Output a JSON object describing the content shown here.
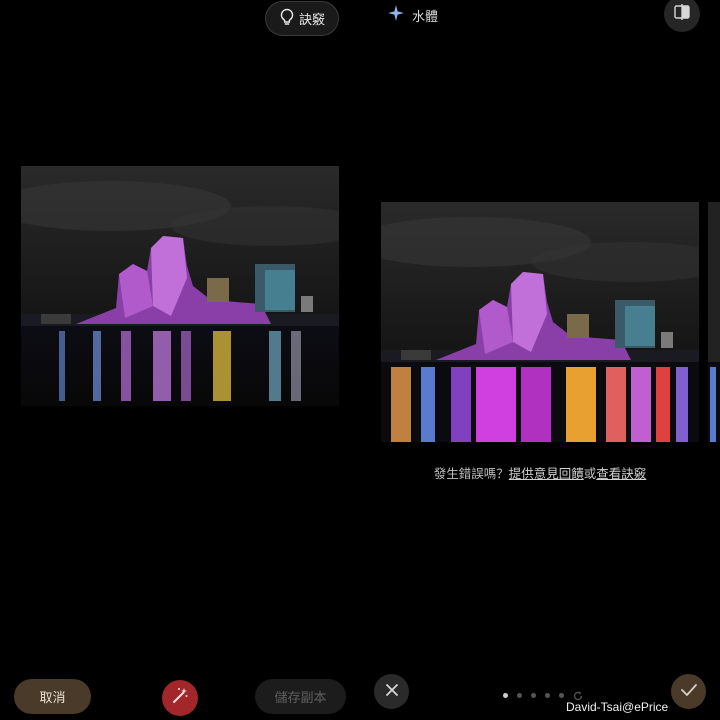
{
  "top_bar": {
    "tips_label": "訣竅",
    "style_label": "水體",
    "icons": [
      "lightbulb-icon",
      "sparkle-icon",
      "compare-icon"
    ]
  },
  "feedback": {
    "prefix": "發生錯誤嗎？",
    "link_feedback": "提供意見回饋",
    "conjunction": "或",
    "link_tips": "查看訣竅"
  },
  "bottom_bar": {
    "cancel_label": "取消",
    "save_copy_label": "儲存副本",
    "page_count": 5,
    "active_page": 1,
    "icons": [
      "magic-wand-icon",
      "close-icon",
      "refresh-icon",
      "checkmark-icon"
    ]
  },
  "watermark": "David-Tsai@ePrice",
  "colors": {
    "background": "#000000",
    "cancel_bg": "#4a3a2a",
    "magic_bg": "#a3262a",
    "confirm_bg": "#4a3a2a"
  }
}
